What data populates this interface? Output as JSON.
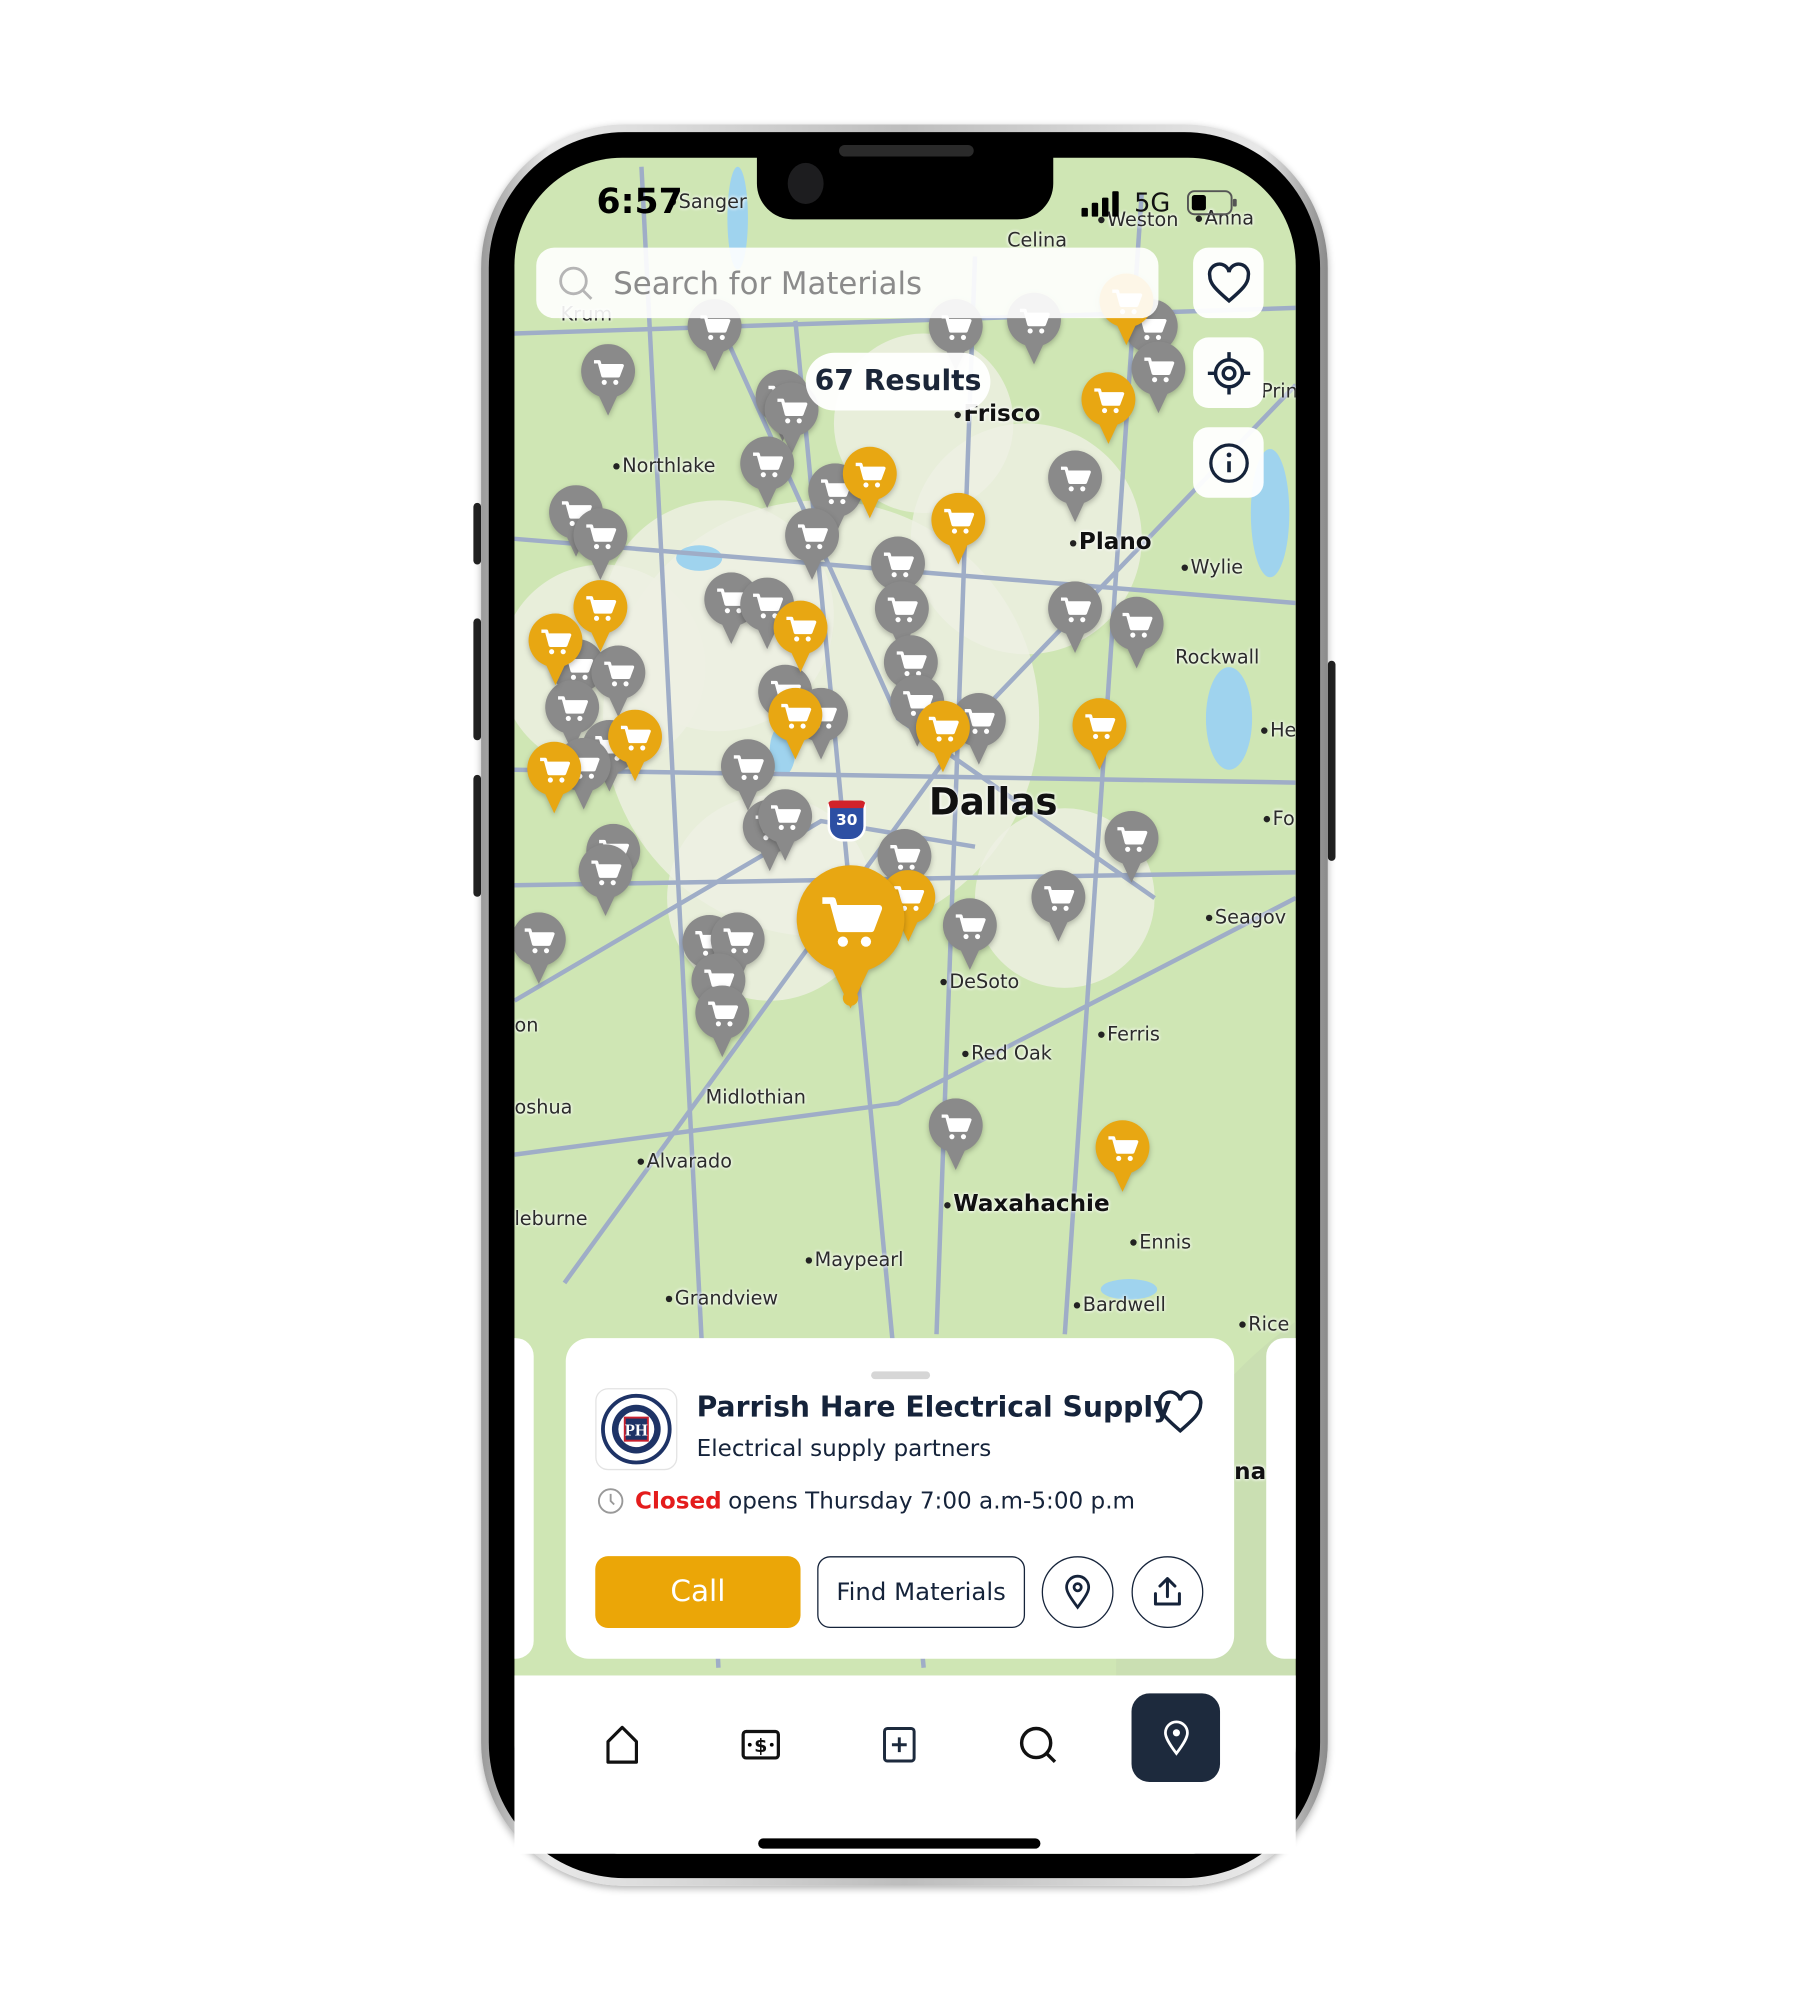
{
  "status_bar": {
    "time": "6:57",
    "network": "5G"
  },
  "search": {
    "placeholder": "Search for Materials"
  },
  "results_badge": "67 Results",
  "map": {
    "places": [
      "Sanger",
      "Weston",
      "Anna",
      "Celina",
      "Krum",
      "Frisco",
      "Northlake",
      "Plano",
      "Wylie",
      "Rockwall",
      "Dallas",
      "Seagov",
      "DeSoto",
      "Ferris",
      "Red Oak",
      "Midlothian",
      "Alvarado",
      "Waxahachie",
      "Ennis",
      "Maypearl",
      "Grandview",
      "Bardwell",
      "Rice",
      "leburne",
      "oshua",
      "on",
      "He",
      "Fo",
      "Prin",
      "na"
    ],
    "highway_shield": "30",
    "marker_colors": {
      "partner": "#e8a712",
      "store": "#8a8a8a"
    }
  },
  "card": {
    "title": "Parrish Hare Electrical Supply",
    "subtitle": "Electrical supply partners",
    "status": "Closed",
    "hours": "opens Thursday 7:00 a.m-5:00 p.m",
    "call_label": "Call",
    "find_label": "Find Materials",
    "logo_text": "PH"
  },
  "nav": {
    "items": [
      "home",
      "money",
      "add",
      "search",
      "map"
    ],
    "active": "map"
  },
  "colors": {
    "accent": "#eba607",
    "dark": "#1d2a3d",
    "closed": "#e41c1c"
  }
}
